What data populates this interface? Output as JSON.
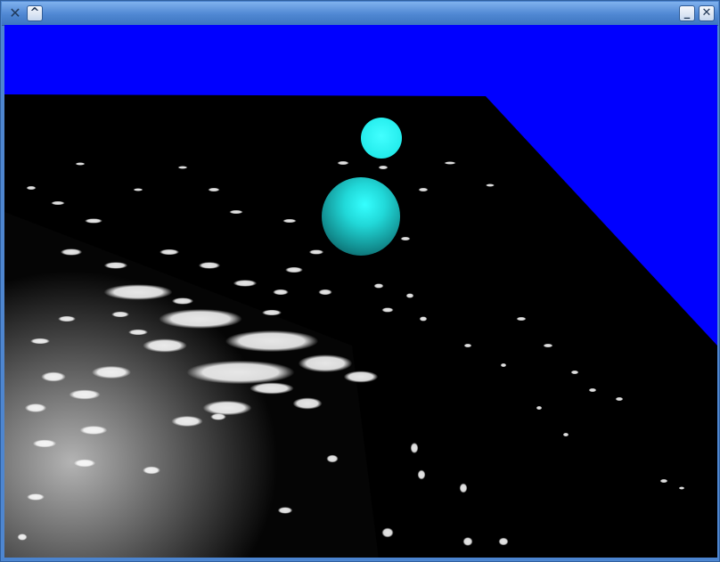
{
  "window": {
    "title": "",
    "buttons": {
      "app_icon": "✕",
      "roll_up": "^",
      "minimize": "_",
      "close": "✕"
    }
  },
  "scene": {
    "sky_color": "#0000ff",
    "floor_color": "#000000",
    "light_color": "#ffffff",
    "sphere_color": "#19e6e6",
    "objects": [
      "small-sphere",
      "large-sphere",
      "floor-plane",
      "caustic-reflections"
    ]
  }
}
